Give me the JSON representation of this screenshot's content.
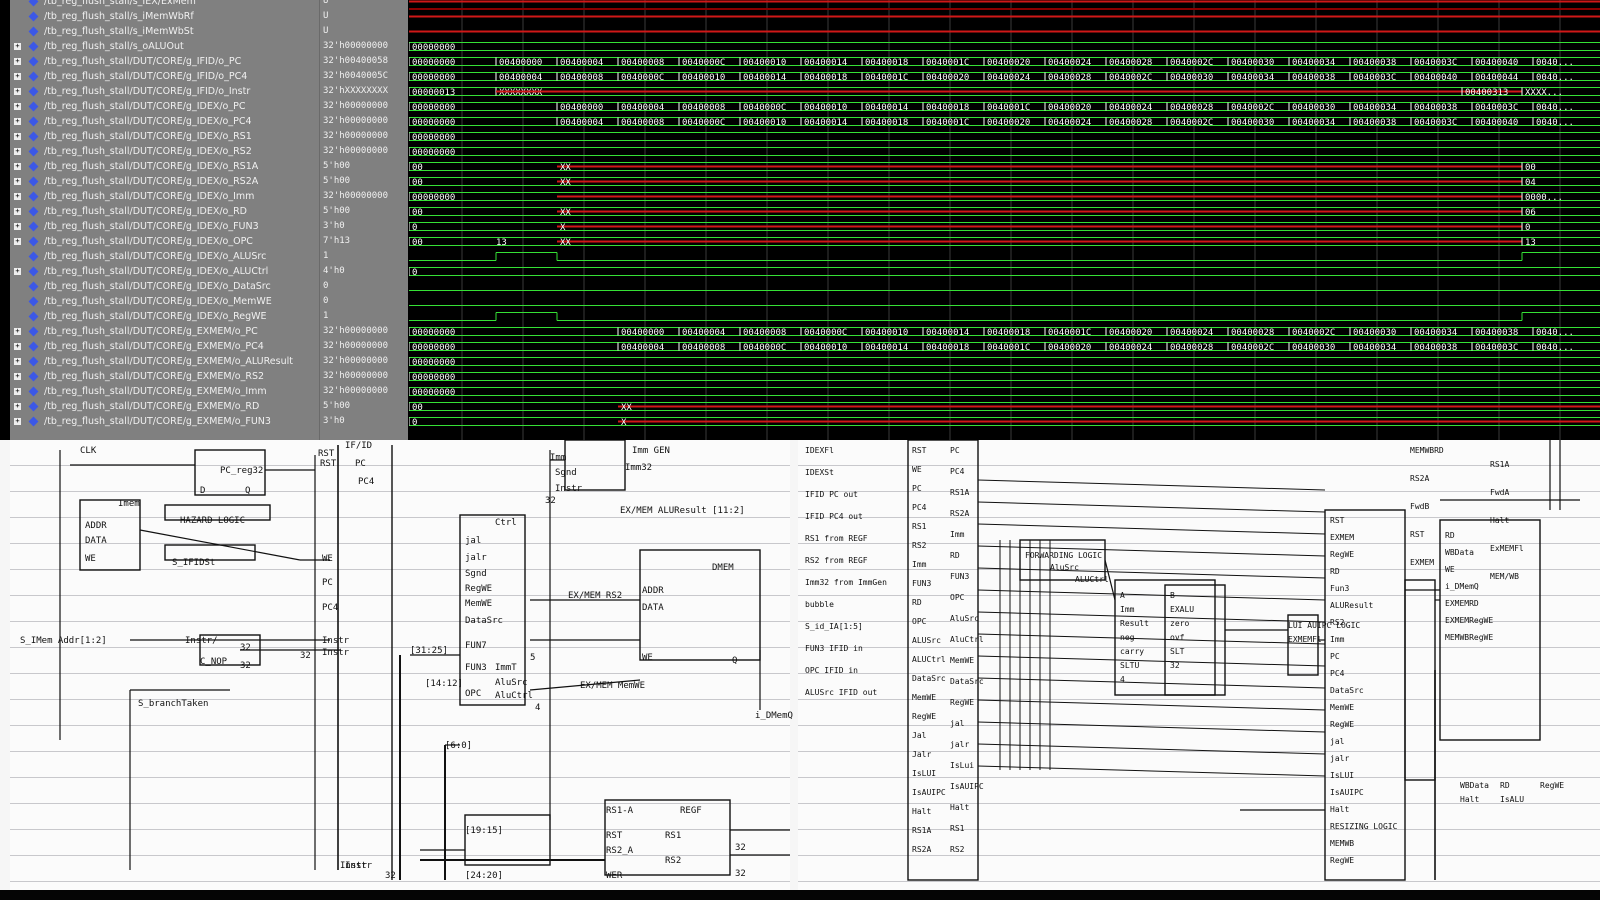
{
  "wave_viewer": {
    "signals": [
      {
        "name": "/tb_reg_flush_stall/s_IEX/ExMem",
        "value": "U"
      },
      {
        "name": "/tb_reg_flush_stall/s_iMemWbRf",
        "value": "U"
      },
      {
        "name": "/tb_reg_flush_stall/s_iMemWbSt",
        "value": "U"
      },
      {
        "name": "/tb_reg_flush_stall/s_oALUOut",
        "value": "32'h00000000"
      },
      {
        "name": "/tb_reg_flush_stall/DUT/CORE/g_IFID/o_PC",
        "value": "32'h00400058"
      },
      {
        "name": "/tb_reg_flush_stall/DUT/CORE/g_IFID/o_PC4",
        "value": "32'h0040005C"
      },
      {
        "name": "/tb_reg_flush_stall/DUT/CORE/g_IFID/o_Instr",
        "value": "32'hXXXXXXXX"
      },
      {
        "name": "/tb_reg_flush_stall/DUT/CORE/g_IDEX/o_PC",
        "value": "32'h00000000"
      },
      {
        "name": "/tb_reg_flush_stall/DUT/CORE/g_IDEX/o_PC4",
        "value": "32'h00000000"
      },
      {
        "name": "/tb_reg_flush_stall/DUT/CORE/g_IDEX/o_RS1",
        "value": "32'h00000000"
      },
      {
        "name": "/tb_reg_flush_stall/DUT/CORE/g_IDEX/o_RS2",
        "value": "32'h00000000"
      },
      {
        "name": "/tb_reg_flush_stall/DUT/CORE/g_IDEX/o_RS1A",
        "value": "5'h00"
      },
      {
        "name": "/tb_reg_flush_stall/DUT/CORE/g_IDEX/o_RS2A",
        "value": "5'h00"
      },
      {
        "name": "/tb_reg_flush_stall/DUT/CORE/g_IDEX/o_Imm",
        "value": "32'h00000000"
      },
      {
        "name": "/tb_reg_flush_stall/DUT/CORE/g_IDEX/o_RD",
        "value": "5'h00"
      },
      {
        "name": "/tb_reg_flush_stall/DUT/CORE/g_IDEX/o_FUN3",
        "value": "3'h0"
      },
      {
        "name": "/tb_reg_flush_stall/DUT/CORE/g_IDEX/o_OPC",
        "value": "7'h13"
      },
      {
        "name": "/tb_reg_flush_stall/DUT/CORE/g_IDEX/o_ALUSrc",
        "value": "1"
      },
      {
        "name": "/tb_reg_flush_stall/DUT/CORE/g_IDEX/o_ALUCtrl",
        "value": "4'h0"
      },
      {
        "name": "/tb_reg_flush_stall/DUT/CORE/g_IDEX/o_DataSrc",
        "value": "0"
      },
      {
        "name": "/tb_reg_flush_stall/DUT/CORE/g_IDEX/o_MemWE",
        "value": "0"
      },
      {
        "name": "/tb_reg_flush_stall/DUT/CORE/g_IDEX/o_RegWE",
        "value": "1"
      },
      {
        "name": "/tb_reg_flush_stall/DUT/CORE/g_EXMEM/o_PC",
        "value": "32'h00000000"
      },
      {
        "name": "/tb_reg_flush_stall/DUT/CORE/g_EXMEM/o_PC4",
        "value": "32'h00000000"
      },
      {
        "name": "/tb_reg_flush_stall/DUT/CORE/g_EXMEM/o_ALUResult",
        "value": "32'h00000000"
      },
      {
        "name": "/tb_reg_flush_stall/DUT/CORE/g_EXMEM/o_RS2",
        "value": "32'h00000000"
      },
      {
        "name": "/tb_reg_flush_stall/DUT/CORE/g_EXMEM/o_Imm",
        "value": "32'h00000000"
      },
      {
        "name": "/tb_reg_flush_stall/DUT/CORE/g_EXMEM/o_RD",
        "value": "5'h00"
      },
      {
        "name": "/tb_reg_flush_stall/DUT/CORE/g_EXMEM/o_FUN3",
        "value": "3'h0"
      }
    ],
    "bus_labels": {
      "zero8": "00000000",
      "instr_first": "00000013",
      "xxx": "XXXXXXXX",
      "xx": "XX",
      "x": "X",
      "zz": "00",
      "z": "0",
      "opc_13": "13",
      "ifid_pc": [
        "00400000",
        "00400004",
        "00400008",
        "0040000C",
        "00400010",
        "00400014",
        "00400018",
        "0040001C",
        "00400020",
        "00400024",
        "00400028",
        "0040002C",
        "00400030",
        "00400034",
        "00400038",
        "0040003C",
        "00400040",
        "0040..."
      ],
      "ifid_pc4": [
        "00400004",
        "00400008",
        "0040000C",
        "00400010",
        "00400014",
        "00400018",
        "0040001C",
        "00400020",
        "00400024",
        "00400028",
        "0040002C",
        "00400030",
        "00400034",
        "00400038",
        "0040003C",
        "00400040",
        "00400044",
        "0040..."
      ],
      "idex_pc": [
        "00400000",
        "00400004",
        "00400008",
        "0040000C",
        "00400010",
        "00400014",
        "00400018",
        "0040001C",
        "00400020",
        "00400024",
        "00400028",
        "0040002C",
        "00400030",
        "00400034",
        "00400038",
        "0040003C",
        "0040..."
      ],
      "idex_pc4": [
        "00400004",
        "00400008",
        "0040000C",
        "00400010",
        "00400014",
        "00400018",
        "0040001C",
        "00400020",
        "00400024",
        "00400028",
        "0040002C",
        "00400030",
        "00400034",
        "00400038",
        "0040003C",
        "00400040",
        "0040..."
      ],
      "exmem_pc": [
        "00400000",
        "00400004",
        "00400008",
        "0040000C",
        "00400010",
        "00400014",
        "00400018",
        "0040001C",
        "00400020",
        "00400024",
        "00400028",
        "0040002C",
        "00400030",
        "00400034",
        "00400038",
        "0040..."
      ],
      "exmem_pc4": [
        "00400004",
        "00400008",
        "0040000C",
        "00400010",
        "00400014",
        "00400018",
        "0040001C",
        "00400020",
        "00400024",
        "00400028",
        "0040002C",
        "00400030",
        "00400034",
        "00400038",
        "0040003C",
        "0040..."
      ],
      "ifid_instr_end": [
        "00400313",
        "XXXX..."
      ],
      "idex_end": {
        "rs1a": "00",
        "rs2a": "04",
        "imm": "0000...",
        "rd": "06",
        "fun3": "0",
        "opc": "13",
        "opc_mid": "13"
      }
    }
  },
  "schematic": {
    "left_sheet": {
      "labels": [
        "CLK",
        "PC_reg32",
        "RST",
        "D",
        "Q",
        "Imem",
        "ADDR",
        "DATA",
        "WE",
        "HAZARD LOGIC",
        "S_IFIDSt",
        "WE",
        "PC",
        "PC4",
        "Instr",
        "S_IMem Addr[1:2]",
        "Instr/",
        "Instr",
        "C_NOP",
        "32",
        "32",
        "32",
        "S_branchTaken",
        "IF/ID",
        "PC",
        "PC4",
        "RST",
        "Instr"
      ]
    },
    "middle_sheet": {
      "labels": [
        "Imm GEN",
        "Imm32",
        "Imm",
        "Sgnd",
        "Instr",
        "32",
        "Ctrl",
        "jal",
        "jalr",
        "Sgnd",
        "RegWE",
        "MemWE",
        "DataSrc",
        "FUN7",
        "FUN3",
        "OPC",
        "ImmT",
        "AluSrc",
        "AluCtrl",
        "[31:25]",
        "[14:12]",
        "[6:0]",
        "5",
        "4",
        "EX/MEM ALUResult [11:2]",
        "EX/MEM RS2",
        "ADDR",
        "DATA",
        "DMEM",
        "WE",
        "Q",
        "EX/MEM MemWE",
        "i_DMemQ",
        "[19:15]",
        "[24:20]",
        "RS1-A",
        "RS2_A",
        "RST",
        "WER",
        "REGF",
        "RS1",
        "RS2",
        "32",
        "32",
        "Instr",
        "32"
      ]
    },
    "right_sheet": {
      "labels": [
        "IDEXFl",
        "IDEXSt",
        "IFID PC out",
        "IFID PC4 out",
        "RS1 from REGF",
        "RS2 from REGF",
        "Imm32 from ImmGen",
        "bubble",
        "S_id_IA[1:5]",
        "FUN3 IFID in",
        "OPC IFID in",
        "ALUSrc IFID out",
        "RST",
        "WE",
        "PC",
        "PC4",
        "RS1",
        "RS2",
        "Imm",
        "FUN3",
        "RD",
        "OPC",
        "ALUSrc",
        "ALUCtrl",
        "DataSrc",
        "MemWE",
        "RegWE",
        "Jal",
        "Jalr",
        "IsLUI",
        "IsAUIPC",
        "Halt",
        "RS1A",
        "RS2A",
        "PC",
        "PC4",
        "RS1A",
        "RS2A",
        "Imm",
        "RD",
        "FUN3",
        "OPC",
        "AluSrc",
        "AluCtrl",
        "MemWE",
        "DataSrc",
        "RegWE",
        "jal",
        "jalr",
        "IsLui",
        "IsAUIPC",
        "Halt",
        "RS1",
        "RS2",
        "FORWARDING LOGIC",
        "AluSrc",
        "ALUCtrl",
        "A",
        "B",
        "Imm",
        "EXALU",
        "Result",
        "zero",
        "neg",
        "ovf",
        "carry",
        "SLT",
        "SLTU",
        "32",
        "4",
        "LUI AUIPC LOGIC",
        "EXMEMFl",
        "RST",
        "EXMEM",
        "RegWE",
        "RD",
        "Fun3",
        "ALUResult",
        "RS2",
        "Imm",
        "PC",
        "PC4",
        "DataSrc",
        "MemWE",
        "RegWE",
        "jal",
        "jalr",
        "IsLUI",
        "IsAUIPC",
        "Halt",
        "RESIZING LOGIC",
        "MEMWB",
        "RegWE",
        "RD",
        "WBData",
        "WE",
        "i_DMemQ",
        "EXMEMRD",
        "EXMEMRegWE",
        "MEMWBRegWE",
        "MEMWBRD",
        "RS1A",
        "RS2A",
        "FwdA",
        "FwdB",
        "Halt",
        "RST",
        "ExMEMFl",
        "EXMEM",
        "MEM/WB",
        "WBData",
        "RD",
        "RegWE",
        "Halt",
        "IsALU"
      ]
    }
  },
  "colors": {
    "name_pane": "#808080",
    "wave_bg": "#000000",
    "wave_green": "#35e035",
    "wave_red": "#d01818",
    "icon_blue": "#3c58e6",
    "paper": "#fbfbfb",
    "ink": "#111111"
  }
}
